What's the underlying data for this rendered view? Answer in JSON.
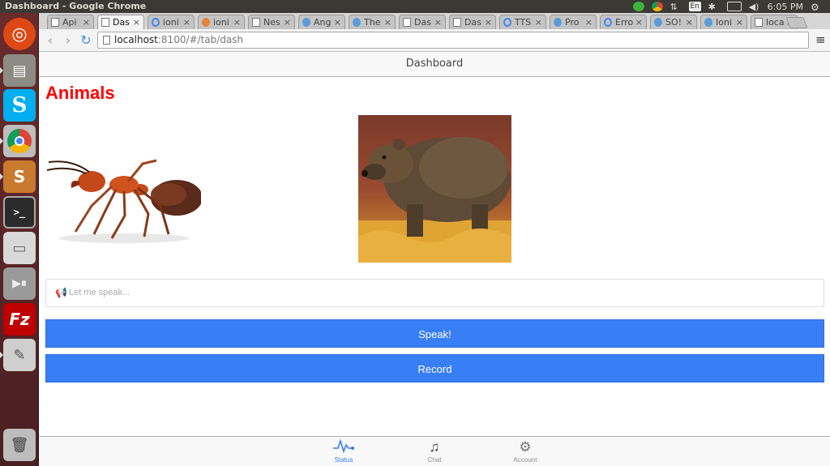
{
  "os": {
    "window_title": "Dashboard - Google Chrome",
    "keyboard_layout": "En",
    "clock": "6:05 PM"
  },
  "launcher": {
    "items": [
      {
        "name": "ubuntu-home",
        "color": "#dd4814"
      },
      {
        "name": "files",
        "color": "#8c8c84"
      },
      {
        "name": "skype",
        "color": "#00aff0"
      },
      {
        "name": "chrome",
        "color": "#4285f4"
      },
      {
        "name": "sublime-text",
        "color": "#c87a2e"
      },
      {
        "name": "terminal",
        "color": "#2b2b2b"
      },
      {
        "name": "disk",
        "color": "#d9d9d9"
      },
      {
        "name": "media-player",
        "color": "#9a9a9a"
      },
      {
        "name": "filezilla",
        "color": "#bf0000"
      },
      {
        "name": "text-editor",
        "color": "#cfcfcf"
      },
      {
        "name": "trash",
        "color": "#bdbdbd"
      }
    ]
  },
  "browser": {
    "tabs": [
      {
        "label": "Api",
        "fav": "page"
      },
      {
        "label": "Das",
        "fav": "page",
        "active": true
      },
      {
        "label": "ioni",
        "fav": "g"
      },
      {
        "label": "ioni",
        "fav": "o"
      },
      {
        "label": "Nes",
        "fav": "page"
      },
      {
        "label": "Ang",
        "fav": "b"
      },
      {
        "label": "The",
        "fav": "b"
      },
      {
        "label": "Das",
        "fav": "page"
      },
      {
        "label": "Das",
        "fav": "page"
      },
      {
        "label": "TTS",
        "fav": "g"
      },
      {
        "label": "Pro",
        "fav": "b"
      },
      {
        "label": "Erro",
        "fav": "g"
      },
      {
        "label": "SO!",
        "fav": "b"
      },
      {
        "label": "Ioni",
        "fav": "b"
      },
      {
        "label": "loca",
        "fav": "page"
      }
    ],
    "url_host": "localhost",
    "url_path": ":8100/#/tab/dash"
  },
  "app": {
    "header_title": "Dashboard",
    "content_title": "Animals",
    "input_placeholder": "Let me speak...",
    "speak_label": "Speak!",
    "record_label": "Record",
    "tabbar": [
      {
        "label": "Status",
        "icon": "pulse-icon",
        "active": true
      },
      {
        "label": "Chat",
        "icon": "music-note-icon",
        "active": false
      },
      {
        "label": "Account",
        "icon": "gear-icon",
        "active": false
      }
    ],
    "accent_color": "#387ef5",
    "title_color": "#ff0000"
  }
}
